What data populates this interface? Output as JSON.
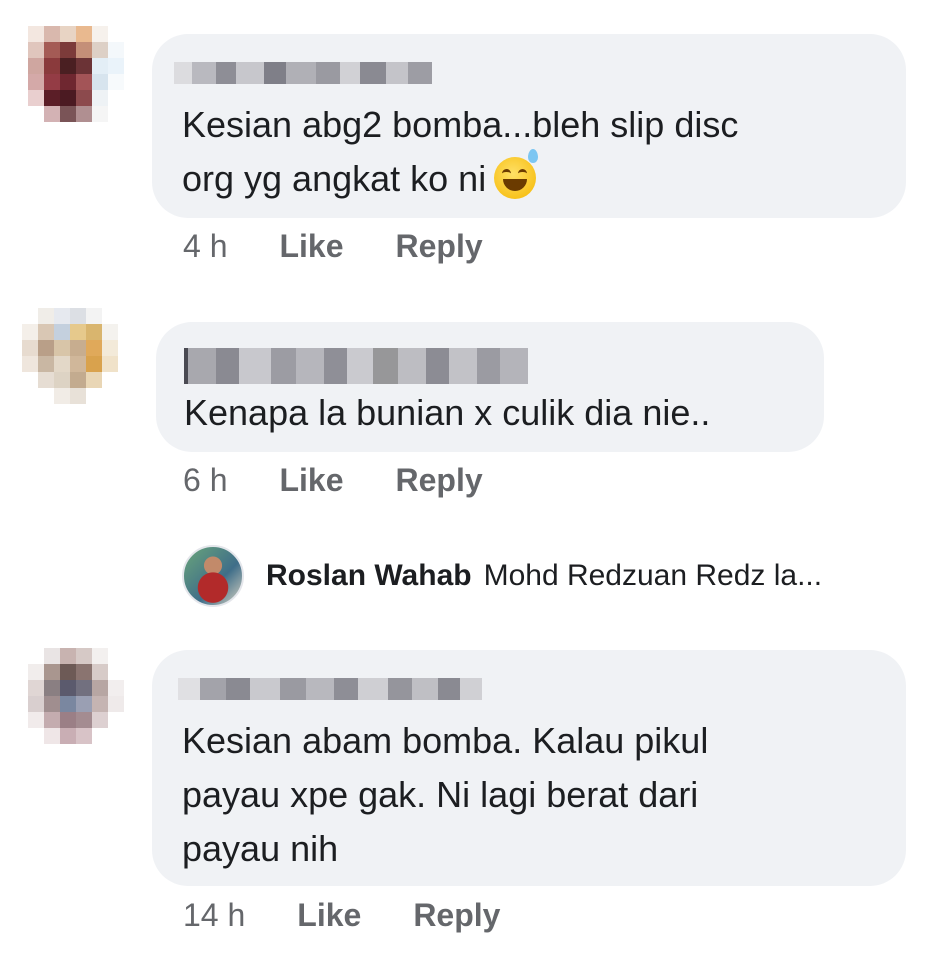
{
  "comments": [
    {
      "lines": [
        "Kesian abg2 bomba...bleh slip disc",
        "org yg angkat ko ni"
      ],
      "emoji": "grinning-sweat-emoji",
      "time": "4 h",
      "like_label": "Like",
      "reply_label": "Reply"
    },
    {
      "lines": [
        "Kenapa la bunian x culik dia nie.."
      ],
      "time": "6 h",
      "like_label": "Like",
      "reply_label": "Reply"
    },
    {
      "lines": [
        "Kesian abam bomba. Kalau pikul",
        "payau xpe gak. Ni lagi berat dari",
        "payau nih"
      ],
      "time": "14 h",
      "like_label": "Like",
      "reply_label": "Reply"
    }
  ],
  "reply_preview": {
    "author": "Roslan Wahab",
    "snippet": "Mohd Redzuan Redz la..."
  },
  "colors": {
    "bubble": "#f0f2f5",
    "text": "#1c1e21",
    "meta": "#65676b"
  }
}
